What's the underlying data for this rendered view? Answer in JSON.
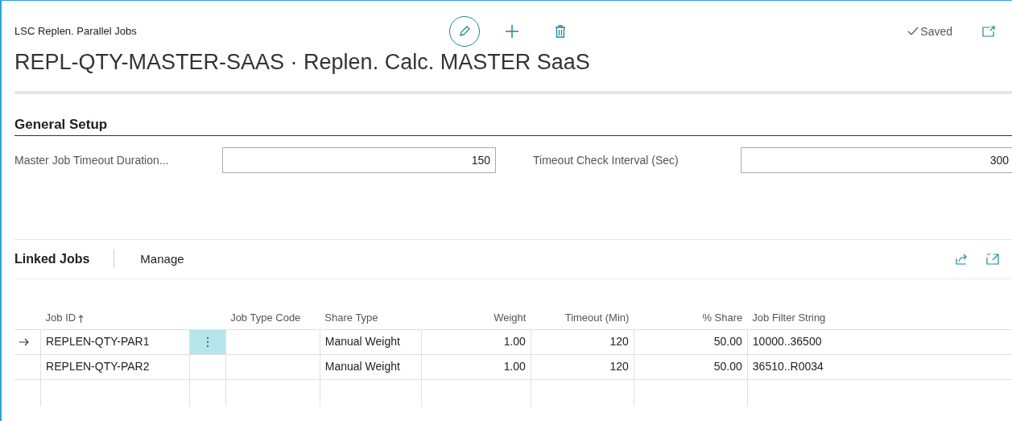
{
  "header": {
    "breadcrumb": "LSC Replen. Parallel Jobs",
    "title": "REPL-QTY-MASTER-SAAS · Replen. Calc. MASTER SaaS",
    "status": "Saved"
  },
  "general_setup": {
    "title": "General Setup",
    "fields": [
      {
        "label": "Master Job Timeout Duration...",
        "value": "150"
      },
      {
        "label": "Timeout Check Interval (Sec)",
        "value": "300"
      }
    ]
  },
  "linked_jobs": {
    "title": "Linked Jobs",
    "actions": [
      "Manage"
    ],
    "columns": [
      "Job ID",
      "Job Type Code",
      "Share Type",
      "Weight",
      "Timeout (Min)",
      "% Share",
      "Job Filter String"
    ],
    "rows": [
      {
        "selected": true,
        "cells": [
          "REPLEN-QTY-PAR1",
          "",
          "Manual Weight",
          "1.00",
          "120",
          "50.00",
          "10000..36500"
        ]
      },
      {
        "selected": false,
        "cells": [
          "REPLEN-QTY-PAR2",
          "",
          "Manual Weight",
          "1.00",
          "120",
          "50.00",
          "36510..R0034"
        ]
      }
    ]
  }
}
